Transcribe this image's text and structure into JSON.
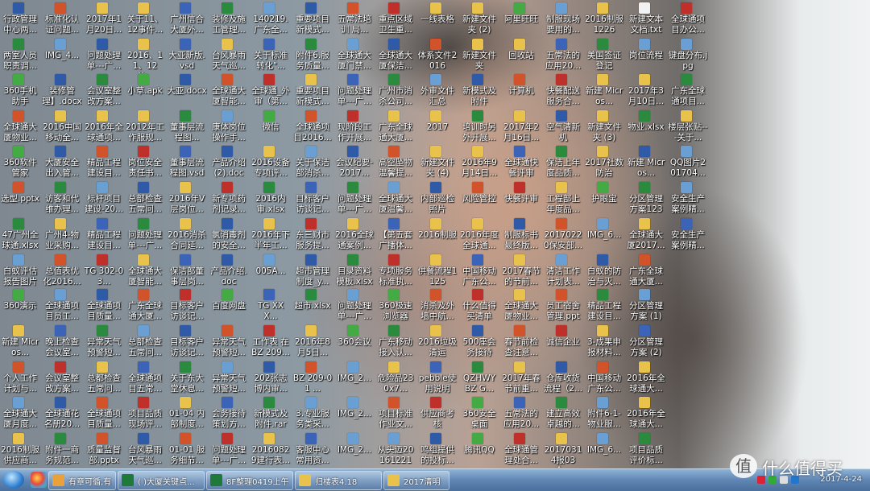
{
  "desktop": {
    "icons": [
      [
        "行政管理中心两...",
        "两室人员职责调...",
        "360手机助手",
        "全球通大厦物业...",
        "360软件管家",
        "选型.pptx",
        "47广州全球通.xlsx",
        "白蚁评估报告图片",
        "360演示",
        "新建 Micros...",
        "个人工作计划与...",
        "全球通大厦月度...",
        "2016制服供应商..."
      ],
      [
        "标准化认证问题...",
        "IMG_4...",
        "装修管理】.docx",
        "2016中国移动全...",
        "大厦安全出入管...",
        "访客和代维办理...",
        "广州4-物业采购...",
        "总值表优化2016...",
        "全球通项目员工...",
        "晚上检查会议室...",
        "会议室整改方案...",
        "全球通花名册20...",
        "附件一商务规范..."
      ],
      [
        "2017年1月20日...",
        "问题处理单---广...",
        "会议室整改方案...",
        "2016年全球通项...",
        "精品工程建设目...",
        "标杆项目建设-20...",
        "精品工程建设目...",
        "TG 302-03...",
        "全球通项目质量...",
        "异常天气预警短...",
        "总都检查五常问...",
        "全球通项目质量...",
        "质量监督部.pptx"
      ],
      [
        "关于11、12事件...",
        "2016、11、12关...",
        "小草.apk",
        "2012年工作服规...",
        "岗位安全责任书...",
        "总部检查五常问...",
        "问题处理单---广...",
        "全球通大厦智能...",
        "广东全球通大厦...",
        "总部检查五常问...",
        "全球通项目五常...",
        "项目品质现场评...",
        "台风暴雨天气巡..."
      ],
      [
        "广州信合大厦外...",
        "大亚新版.vsd",
        "大亚.docx",
        "董事层流程图...",
        "董事层流程图.vsd",
        "2016年V层岗位...",
        "2016消杀合同延...",
        "保洁部董事层岗...",
        "目标客户访谈记...",
        "目标客户访谈记...",
        "关于东大堂休息...",
        "01-04 内部制度...",
        "01-01 服务细节..."
      ],
      [
        "装修及施工管理...",
        "台风暴雨天气巡...",
        "全球通大厦智能...",
        "康体岗位操作手...",
        "产品介绍(2).doc",
        "新专项药剂记录...",
        "氯消毒剂的安全...",
        "产品介绍.doc",
        "百度网盘",
        "异常天气预警短...",
        "异常天气预警短...",
        "会务接待策划方...",
        "问题处理单---广..."
      ],
      [
        "140219.广东全...",
        "关于标准转化\"...",
        "全球通_外审（第...",
        "微信",
        "2016设备专项评...",
        "2016内审.xlsx",
        "2016年下半年工...",
        "005A...",
        "TG XX X...",
        "工作表 在 BZ 209...",
        "202张志博内审...",
        "新模式及附件.rar",
        "20160829建行表..."
      ],
      [
        "重要项目新模式...",
        "附件6.服务质量...",
        "重要项目新模式...",
        "全球通项目2016...",
        "关于保洁部消杀...",
        "目标客户访谈记...",
        "东三财市服务提...",
        "超市管理制度_y...",
        "超市.xlsx",
        "2016年8月5日...",
        "BZ 209-01 ...",
        "3.专业服务类采...",
        "客服中心常用资..."
      ],
      [
        "五常法培训 局...",
        "全球通大厦门禁...",
        "问题处理单---广...",
        "现阶段工作开展...",
        "会议纪要-2017...",
        "问题处理单---广...",
        "2016全球通案例...",
        "目录资料模板.xlsx",
        "问题处理单---广...",
        "360会议",
        "IMG_2...",
        "IMG_2...",
        "IMG_2..."
      ],
      [
        "重点区域卫生重...",
        "全球通大厦保洁...",
        "广州市消杀公司...",
        "广东全球通大厦...",
        "高空坠物温馨提...",
        "全球通大厦温馨...",
        "【第五套广播体...",
        "专项服务标准执...",
        "360极速浏览器",
        "广东移动接入认...",
        "危险品230x7...",
        "项目标准作业文...",
        "从头迈20161221"
      ],
      [
        "一线表格",
        "体系文件2016",
        "外审文件汇总",
        "2017",
        "新建文件夹 (4)",
        "内部巡检照片",
        "2016制服",
        "供餐流程1125",
        "消杀及外墙中航...",
        "2016垃圾清运",
        "pebble使用说明",
        "供应商考核",
        "鸣组提供的投标..."
      ],
      [
        "新建文件夹 (2)",
        "新建文件夹",
        "新模式及附件",
        "培训时另外开展...",
        "2016年9月14日...",
        "风险管控",
        "2016年度全球通...",
        "中国移动广东公...",
        "什么值得买清单",
        "500座会务接待",
        "QZHWY BZ G...",
        "360安全桌面",
        "腾讯QQ"
      ],
      [
        "阿里旺旺",
        "回收站",
        "计算机",
        "2017年2月16日...",
        "全球通快餐评审",
        "快餐评审",
        "制服标书最终版...",
        "2017春节的节前...",
        "全球通大厦物业...",
        "春节前检查注意...",
        "2017年春节前重...",
        "五常法的应用20...",
        "全球通管理处合..."
      ],
      [
        "制服现场要用的...",
        "五常法的应用20...",
        "快餐配送服务合...",
        "空气清新机",
        "保洁上年度品质...",
        "工程部上年度品...",
        "20170220保安部...",
        "清洁工作计划表...",
        "员工宿舍管理.ppt",
        "诚信企业",
        "仓库收货流程（2...",
        "建立高效卓越的...",
        "20170314报03 全..."
      ],
      [
        "2016制服1226",
        "美国签证登记",
        "新建 Micros...",
        "新建文件夹 (3)",
        "2017社数防治",
        "护眼宝",
        "IMG_6...",
        "白蚁的防治与灭...",
        "精品工程建设目...",
        "3-成果申报材料...",
        "中国移动广东公...",
        "附件6-1-物业服...",
        "IMG_6..."
      ],
      [
        "新建文本文档.txt",
        "岗位流程",
        "2017年3月10日...",
        "物业.xlsx",
        "新建 Micros...",
        "分区管理方案123",
        "全球通大厦2017...",
        "广东全球通大厦...",
        "分区管理方案 (1)",
        "分区管理方案 (2)",
        "2016年全球通大...",
        "2016年全球通大...",
        "项目品质评价标..."
      ],
      [
        "全球通项目办公...",
        "键盘分布.jpg",
        "广东全球通项目...",
        "楼层张贴---关于...",
        "QQ图片201704...",
        "安全生产案例精...",
        "安全生产案例精...",
        "",
        "",
        "",
        "",
        "",
        ""
      ]
    ]
  },
  "taskbar": {
    "tasks": [
      {
        "label": "有章可循,有法可..."
      },
      {
        "label": "(  )大厦关键点..."
      },
      {
        "label": "8F整理0419上午..."
      },
      {
        "label": "归楼表4.18"
      },
      {
        "label": "2017清明"
      }
    ],
    "date": "2017-4-24"
  },
  "watermark": {
    "text": "什么值得买",
    "logo": "值"
  },
  "colors": {
    "taskbar": "#5f86b4",
    "label_text": "#ffffff"
  }
}
